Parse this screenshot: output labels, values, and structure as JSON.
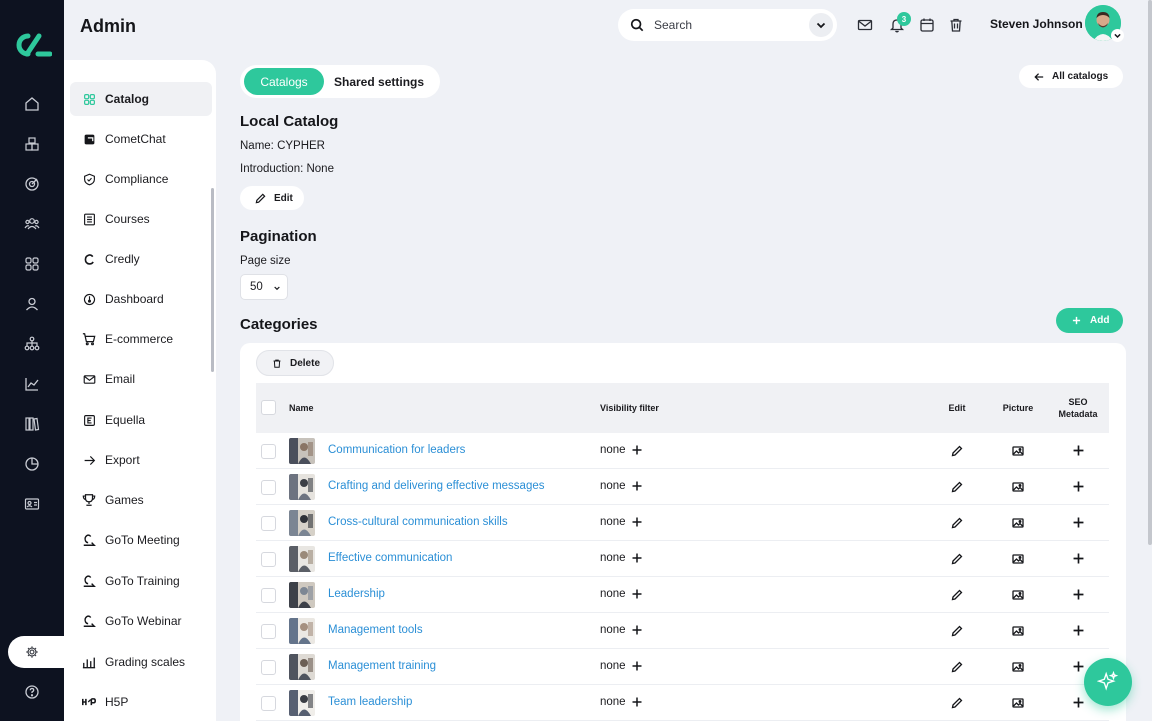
{
  "app": {
    "title": "Admin"
  },
  "search": {
    "placeholder": "Search"
  },
  "notifications": {
    "count": "3"
  },
  "user": {
    "name": "Steven Johnson"
  },
  "colors": {
    "accent": "#2ec89c",
    "rail": "#0d1220",
    "link": "#2b8fd6"
  },
  "rail_icons": [
    "home-icon",
    "cube-icon",
    "target-icon",
    "users-icon",
    "grid-icon",
    "user-icon",
    "hierarchy-icon",
    "chart-icon",
    "books-icon",
    "pie-icon",
    "id-card-icon",
    "settings-icon",
    "help-icon"
  ],
  "sidebar": {
    "items": [
      {
        "label": "Catalog",
        "icon": "grid-icon",
        "active": true
      },
      {
        "label": "CometChat",
        "icon": "chat-icon"
      },
      {
        "label": "Compliance",
        "icon": "shield-icon"
      },
      {
        "label": "Courses",
        "icon": "list-icon"
      },
      {
        "label": "Credly",
        "icon": "credly-icon"
      },
      {
        "label": "Dashboard",
        "icon": "dashboard-icon"
      },
      {
        "label": "E-commerce",
        "icon": "cart-icon"
      },
      {
        "label": "Email",
        "icon": "mail-icon"
      },
      {
        "label": "Equella",
        "icon": "equella-icon"
      },
      {
        "label": "Export",
        "icon": "arrow-right-icon"
      },
      {
        "label": "Games",
        "icon": "trophy-icon"
      },
      {
        "label": "GoTo Meeting",
        "icon": "goto-icon"
      },
      {
        "label": "GoTo Training",
        "icon": "goto-icon"
      },
      {
        "label": "GoTo Webinar",
        "icon": "goto-icon"
      },
      {
        "label": "Grading scales",
        "icon": "bars-icon"
      },
      {
        "label": "H5P",
        "icon": "h5p-icon"
      }
    ]
  },
  "tabs": {
    "active": "Catalogs",
    "other": "Shared settings"
  },
  "all_catalogs_label": "All catalogs",
  "local_catalog": {
    "title": "Local Catalog",
    "name_line": "Name: CYPHER",
    "intro_line": "Introduction: None",
    "edit_label": "Edit"
  },
  "pagination": {
    "title": "Pagination",
    "page_size_label": "Page size",
    "page_size_value": "50"
  },
  "categories": {
    "title": "Categories",
    "add_label": "Add",
    "delete_label": "Delete",
    "columns": {
      "name": "Name",
      "visibility": "Visibility filter",
      "edit": "Edit",
      "picture": "Picture",
      "seo_line1": "SEO",
      "seo_line2": "Metadata"
    },
    "rows": [
      {
        "name": "Communication for leaders",
        "visibility": "none"
      },
      {
        "name": "Crafting and delivering effective messages",
        "visibility": "none"
      },
      {
        "name": "Cross-cultural communication skills",
        "visibility": "none"
      },
      {
        "name": "Effective communication",
        "visibility": "none"
      },
      {
        "name": "Leadership",
        "visibility": "none"
      },
      {
        "name": "Management tools",
        "visibility": "none"
      },
      {
        "name": "Management training",
        "visibility": "none"
      },
      {
        "name": "Team leadership",
        "visibility": "none"
      }
    ]
  }
}
